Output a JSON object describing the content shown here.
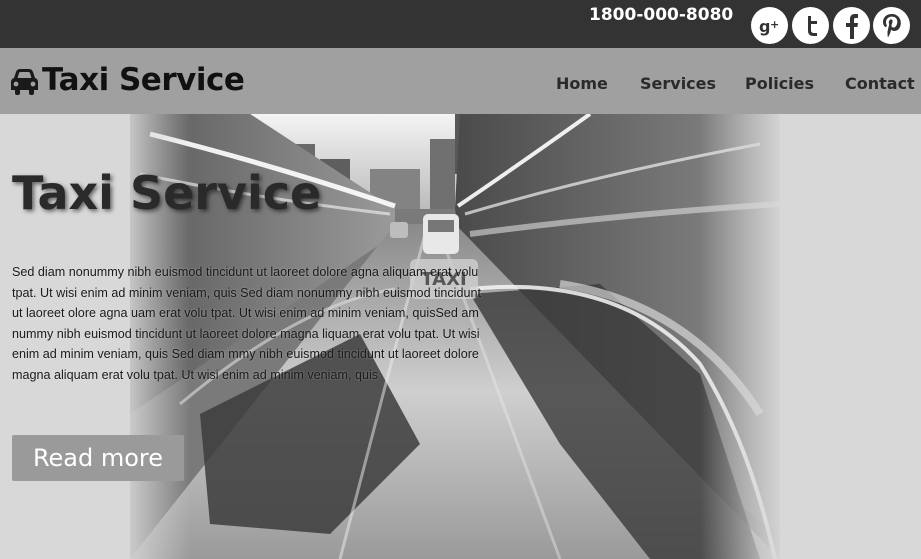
{
  "topbar": {
    "phone": "1800-000-8080",
    "social": [
      {
        "name": "google-plus-icon",
        "glyph": "g+"
      },
      {
        "name": "twitter-icon",
        "glyph": "t"
      },
      {
        "name": "facebook-icon",
        "glyph": "f"
      },
      {
        "name": "pinterest-icon",
        "glyph": "p"
      }
    ]
  },
  "navbar": {
    "brand": "Taxi Service",
    "brand_icon": "car-icon",
    "items": [
      "Home",
      "Services",
      "Policies",
      "Contact"
    ]
  },
  "hero": {
    "title": "Taxi Service",
    "text": "Sed diam nonummy nibh euismod tincidunt ut laoreet dolore agna aliquam erat volu tpat. Ut wisi enim ad minim veniam, quis Sed diam nonummy nibh euismod tincidunt ut laoreet olore agna uam erat volu tpat. Ut wisi enim ad minim veniam, quisSed am nummy nibh euismod tincidunt ut laoreet dolore magna liquam erat volu tpat. Ut wisi enim ad minim veniam, quis Sed diam mmy nibh euismod tincidunt ut laoreet dolore magna aliquam erat volu tpat. Ut wisi enim ad minim veniam, quis",
    "button": "Read more",
    "taxi_sign": "TAXI"
  },
  "colors": {
    "topbar": "#333333",
    "navbar": "#a0a0a0",
    "page": "#d8d8d8",
    "button": "#9a9a9a"
  }
}
